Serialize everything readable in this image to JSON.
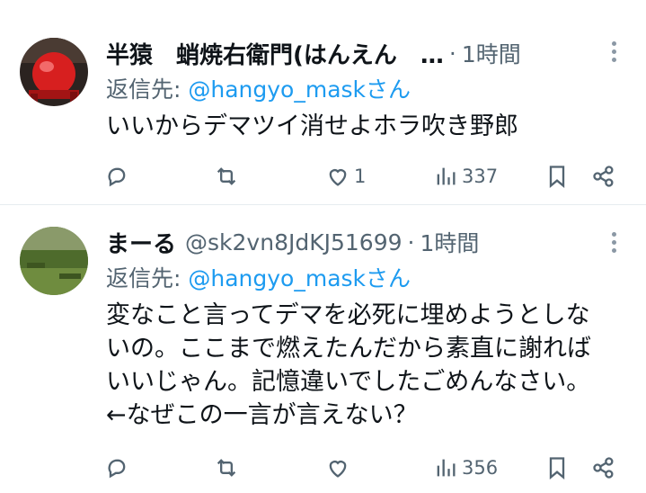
{
  "tweets": [
    {
      "name": "半猿　蛸焼右衛門(はんえん　…",
      "handle": "",
      "dot": "·",
      "time": "1時間",
      "reply_prefix": "返信先: ",
      "reply_to": "@hangyo_maskさん",
      "text": "いいからデマツイ消せよホラ吹き野郎",
      "replies": "",
      "retweets": "",
      "likes": "1",
      "views": "337"
    },
    {
      "name": "まーる",
      "handle": "@sk2vn8JdKJ51699",
      "dot": "·",
      "time": "1時間",
      "reply_prefix": "返信先: ",
      "reply_to": "@hangyo_maskさん",
      "text_lines": [
        "変なこと言ってデマを必死に埋めようとしな",
        "いの。ここまで燃えたんだから素直に謝れば",
        "いいじゃん。記憶違いでしたごめんなさい。",
        "←なぜこの一言が言えない？"
      ],
      "replies": "",
      "retweets": "",
      "likes": "",
      "views": "356"
    }
  ],
  "icons": {
    "reply": "reply-icon",
    "retweet": "retweet-icon",
    "like": "heart-icon",
    "views": "views-icon",
    "bookmark": "bookmark-icon",
    "share": "share-icon",
    "more": "more-icon"
  },
  "colors": {
    "link": "#1d9bf0",
    "secondary": "#536471",
    "text": "#0f1419"
  }
}
